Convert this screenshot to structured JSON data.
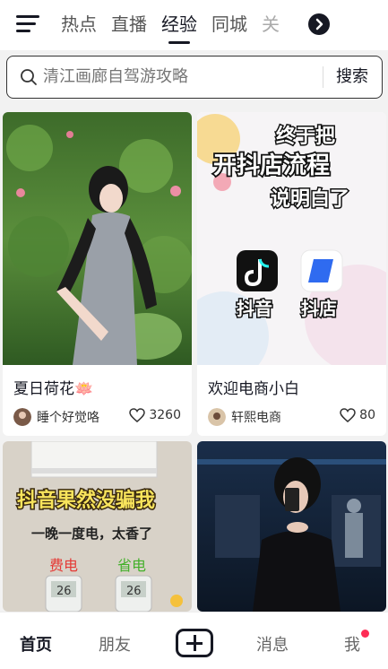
{
  "tabs": [
    {
      "label": "热点",
      "active": false
    },
    {
      "label": "直播",
      "active": false
    },
    {
      "label": "经验",
      "active": true
    },
    {
      "label": "同城",
      "active": false
    },
    {
      "label": "关",
      "active": false
    }
  ],
  "search": {
    "placeholder": "清江画廊自驾游攻略",
    "button": "搜索"
  },
  "cards": [
    {
      "title": "夏日荷花🪷",
      "author": "睡个好觉咯",
      "likes": "3260"
    },
    {
      "title": "欢迎电商小白",
      "author": "轩熙电商",
      "likes": "80",
      "thumb_text": {
        "l1": "终于把",
        "l2": "开抖店流程",
        "l3": "说明白了",
        "app1": "抖音",
        "app2": "抖店"
      }
    },
    {
      "thumb_text": {
        "l1": "抖音果然没骗我",
        "l2": "一晚一度电，太香了",
        "tag1": "费电",
        "tag2": "省电",
        "temp1": "26",
        "temp2": "26"
      }
    },
    {
      "thumb_text": {}
    }
  ],
  "nav": {
    "home": "首页",
    "friends": "朋友",
    "messages": "消息",
    "me": "我"
  },
  "colors": {
    "accent": "#fe2c55",
    "text": "#161823"
  }
}
